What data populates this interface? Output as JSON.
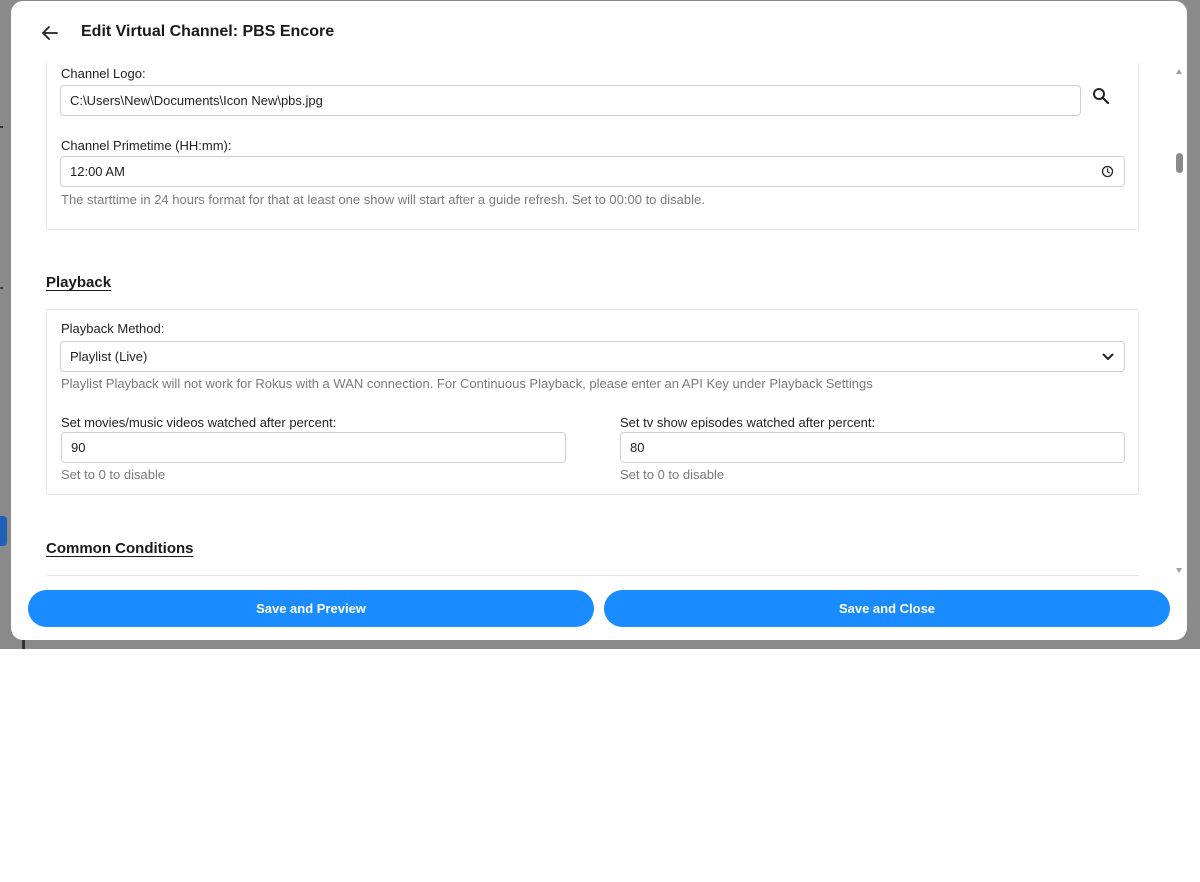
{
  "dialog": {
    "title": "Edit Virtual Channel: PBS Encore"
  },
  "general": {
    "logo_label": "Channel Logo:",
    "logo_value": "C:\\Users\\New\\Documents\\Icon New\\pbs.jpg",
    "primetime_label": "Channel Primetime (HH:mm):",
    "primetime_value": "12:00 AM",
    "primetime_help": "The starttime in 24 hours format for that at least one show will start after a guide refresh. Set to 00:00 to disable."
  },
  "playback": {
    "section_title": "Playback",
    "method_label": "Playback Method:",
    "method_value": "Playlist (Live)",
    "method_help": "Playlist Playback will not work for Rokus with a WAN connection. For Continuous Playback, please enter an API Key under Playback Settings",
    "movies_label": "Set movies/music videos watched after percent:",
    "movies_value": "90",
    "movies_help": "Set to 0 to disable",
    "tv_label": "Set tv show episodes watched after percent:",
    "tv_value": "80",
    "tv_help": "Set to 0 to disable"
  },
  "common": {
    "section_title": "Common Conditions"
  },
  "footer": {
    "save_preview_label": "Save and Preview",
    "save_close_label": "Save and Close"
  },
  "icons": {
    "back": "arrow-left-icon",
    "search": "search-icon",
    "clock": "clock-icon",
    "dropdown": "chevron-down-icon"
  },
  "colors": {
    "primary": "#1a8cff",
    "help_text": "#7a7a7a",
    "backdrop": "#8a8a8a"
  }
}
